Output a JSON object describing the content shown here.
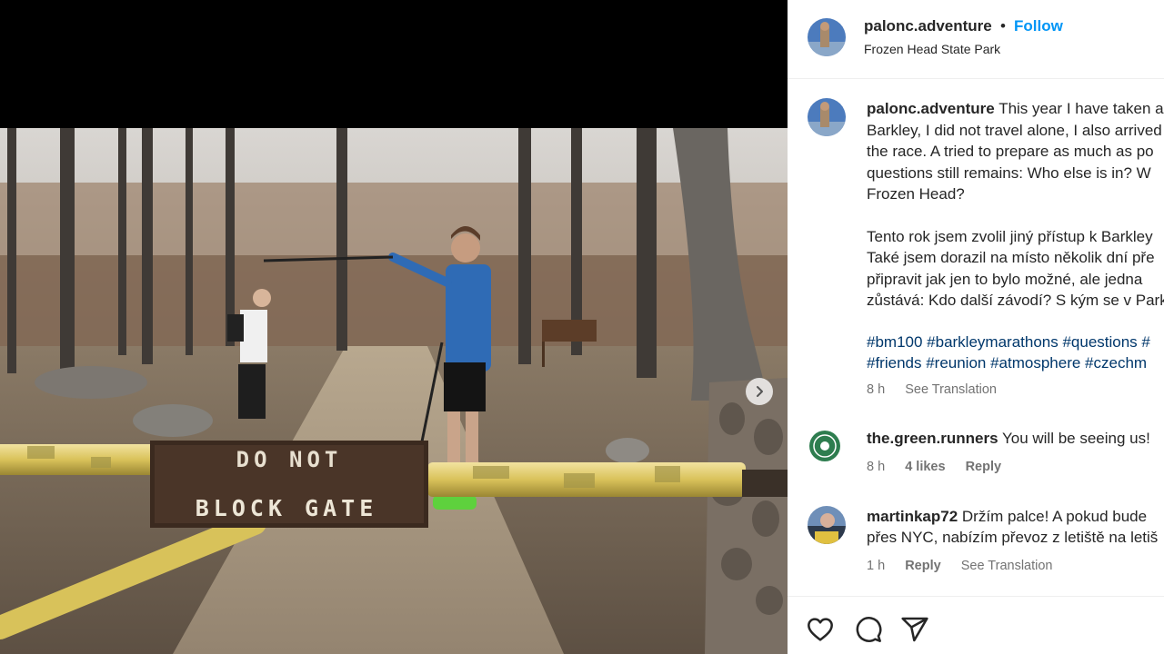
{
  "post": {
    "username": "palonc.adventure",
    "follow_label": "Follow",
    "separator": "•",
    "location": "Frozen Head State Park"
  },
  "photo": {
    "sign_line1": "DO NOT",
    "sign_line2": "BLOCK GATE"
  },
  "caption": {
    "username": "palonc.adventure",
    "lines": [
      "This year I have taken a",
      "Barkley, I did not travel alone, I also arrived",
      "the race. A tried to prepare as much as po",
      "questions still remains: Who else is in? W",
      "Frozen Head?",
      "Tento rok jsem zvolil jiný přístup k Barkley",
      "Také jsem dorazil na místo několik dní pře",
      "připravit jak jen to bylo možné, ale jedna",
      "zůstává: Kdo další závodí? S kým se v Park",
      "#bm100 #barkleymarathons #questions #",
      "#friends #reunion #atmosphere #czechm"
    ],
    "time": "8 h",
    "see_translation": "See Translation"
  },
  "comments": [
    {
      "username": "the.green.runners",
      "text": "You will be seeing us!",
      "time": "8 h",
      "likes": "4 likes",
      "reply": "Reply"
    },
    {
      "username": "martinkap72",
      "line1": "Držím palce! A pokud bude",
      "line2": "přes NYC, nabízím převoz z letiště na letiš",
      "time": "1 h",
      "reply": "Reply",
      "see_translation": "See Translation"
    }
  ],
  "actions": {
    "icons": [
      "heart-icon",
      "comment-icon",
      "share-icon"
    ]
  },
  "colors": {
    "follow": "#0095f6",
    "hashtag": "#00376b",
    "meta": "#737373",
    "text": "#262626"
  }
}
